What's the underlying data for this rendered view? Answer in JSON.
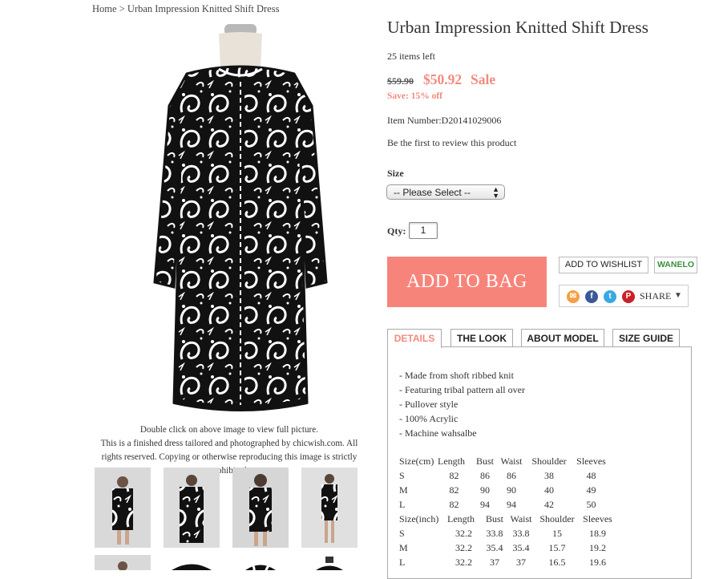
{
  "breadcrumb": {
    "home": "Home",
    "separator": ">",
    "current": "Urban Impression Knitted Shift Dress"
  },
  "product": {
    "title": "Urban Impression Knitted Shift Dress",
    "stock": "25 items left",
    "old_price": "$59.90",
    "new_price": "$50.92",
    "sale_label": "Sale",
    "save_text": "Save: 15% off",
    "item_number": "Item Number:D20141029006",
    "review_text": "Be the first to review this product"
  },
  "options": {
    "size_label": "Size",
    "size_selected": "-- Please Select --",
    "qty_label": "Qty:",
    "qty_value": "1"
  },
  "actions": {
    "add_to_bag": "ADD TO BAG",
    "wishlist": "ADD TO WISHLIST",
    "wanelo": "WANELO",
    "share": "SHARE"
  },
  "social_icons": [
    "email-icon",
    "facebook-icon",
    "twitter-icon",
    "pinterest-icon"
  ],
  "image_caption": {
    "line1": "Double click on above image to view full picture.",
    "line2": "This is a finished dress tailored and photographed by chicwish.com. All rights reserved. Copying or otherwise reproducing this image is strictly prohibited."
  },
  "tabs": [
    "DETAILS",
    "THE LOOK",
    "ABOUT MODEL",
    "SIZE GUIDE"
  ],
  "details": {
    "bullets": [
      "- Made from shoft ribbed knit",
      "- Featuring tribal pattern all over",
      "- Pullover style",
      "- 100% Acrylic",
      "- Machine wahsalbe"
    ],
    "size_cm": {
      "headers": [
        "Size(cm)",
        "Length",
        "Bust",
        "Waist",
        "Shoulder",
        "Sleeves"
      ],
      "rows": [
        [
          "S",
          "82",
          "86",
          "86",
          "38",
          "48"
        ],
        [
          "M",
          "82",
          "90",
          "90",
          "40",
          "49"
        ],
        [
          "L",
          "82",
          "94",
          "94",
          "42",
          "50"
        ]
      ]
    },
    "size_inch": {
      "headers": [
        "Size(inch)",
        "Length",
        "Bust",
        "Waist",
        "Shoulder",
        "Sleeves"
      ],
      "rows": [
        [
          "S",
          "32.2",
          "33.8",
          "33.8",
          "15",
          "18.9"
        ],
        [
          "M",
          "32.2",
          "35.4",
          "35.4",
          "15.7",
          "19.2"
        ],
        [
          "L",
          "32.2",
          "37",
          "37",
          "16.5",
          "19.6"
        ]
      ]
    }
  },
  "colors": {
    "accent": "#f7847a",
    "price": "#f28a7f"
  }
}
